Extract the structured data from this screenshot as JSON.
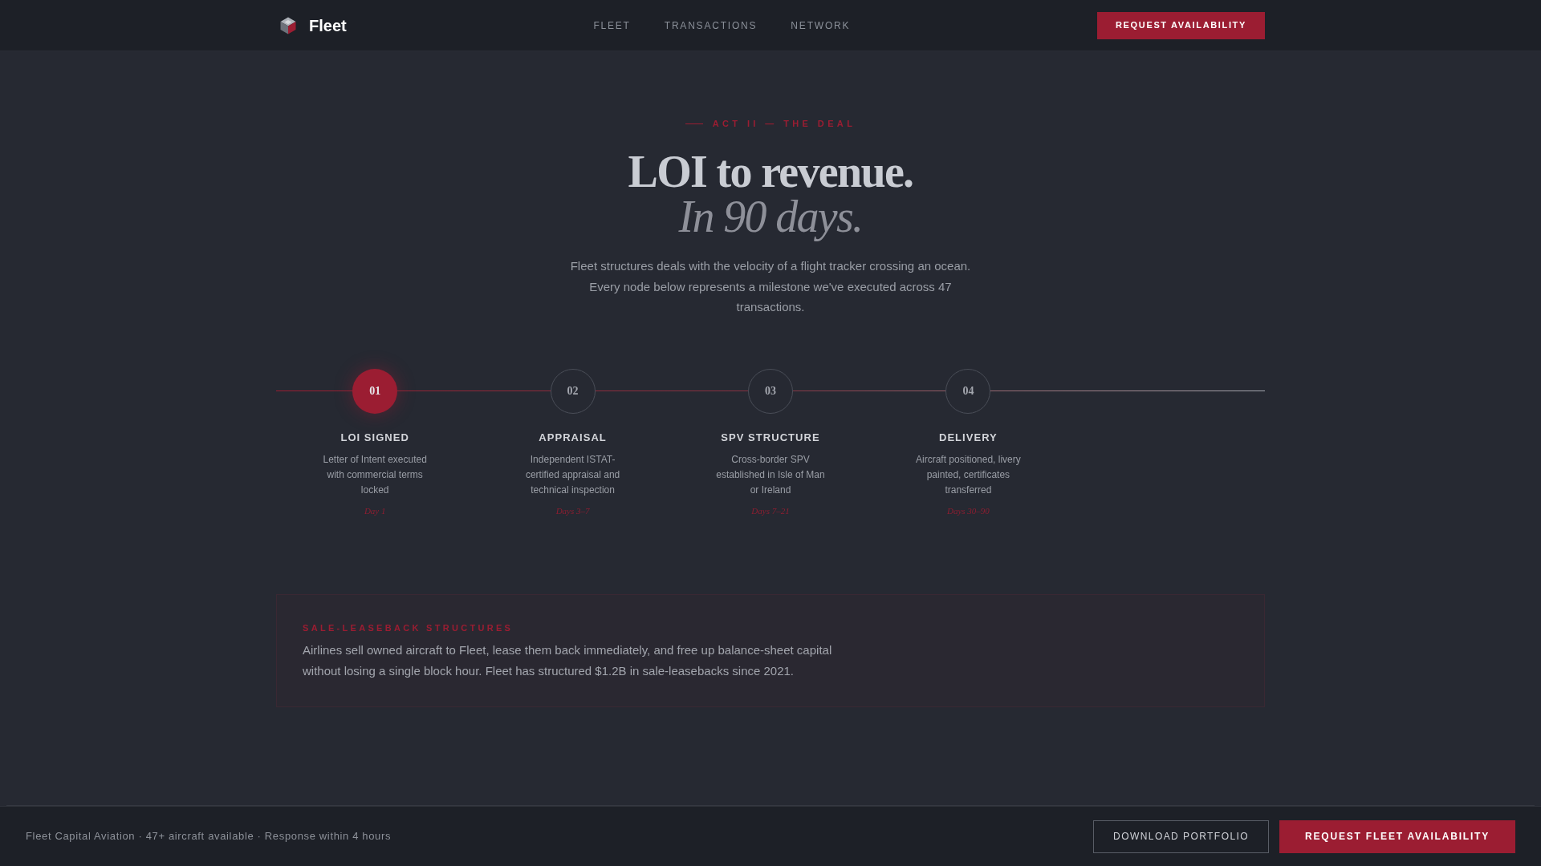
{
  "nav": {
    "brand": "Fleet",
    "links": [
      {
        "label": "FLEET"
      },
      {
        "label": "TRANSACTIONS"
      },
      {
        "label": "NETWORK"
      }
    ],
    "cta": "REQUEST AVAILABILITY"
  },
  "hero": {
    "eyebrow": "ACT II — THE DEAL",
    "title": "LOI to revenue.",
    "title_accent": "In 90 days.",
    "intro": "Fleet structures deals with the velocity of a flight tracker crossing an ocean. Every node below represents a milestone we've executed across 47 transactions."
  },
  "timeline": {
    "steps": [
      {
        "number": "01",
        "title": "LOI SIGNED",
        "description": "Letter of Intent executed with commercial terms locked",
        "timing": "Day 1",
        "active": true
      },
      {
        "number": "02",
        "title": "APPRAISAL",
        "description": "Independent ISTAT-certified appraisal and technical inspection",
        "timing": "Days 3–7",
        "active": false
      },
      {
        "number": "03",
        "title": "SPV STRUCTURE",
        "description": "Cross-border SPV established in Isle of Man or Ireland",
        "timing": "Days 7–21",
        "active": false
      },
      {
        "number": "04",
        "title": "DELIVERY",
        "description": "Aircraft positioned, livery painted, certificates transferred",
        "timing": "Days 30–90",
        "active": false
      }
    ]
  },
  "callout": {
    "eyebrow": "SALE-LEASEBACK STRUCTURES",
    "text": "Airlines sell owned aircraft to Fleet, lease them back immediately, and free up balance-sheet capital without losing a single block hour. Fleet has structured $1.2B in sale-leasebacks since 2021."
  },
  "footer": {
    "tagline": "Fleet Capital Aviation · 47+ aircraft available · Response within 4 hours",
    "buttons": [
      {
        "label": "DOWNLOAD PORTFOLIO",
        "kind": "outline"
      },
      {
        "label": "REQUEST FLEET AVAILABILITY",
        "kind": "primary"
      }
    ]
  }
}
